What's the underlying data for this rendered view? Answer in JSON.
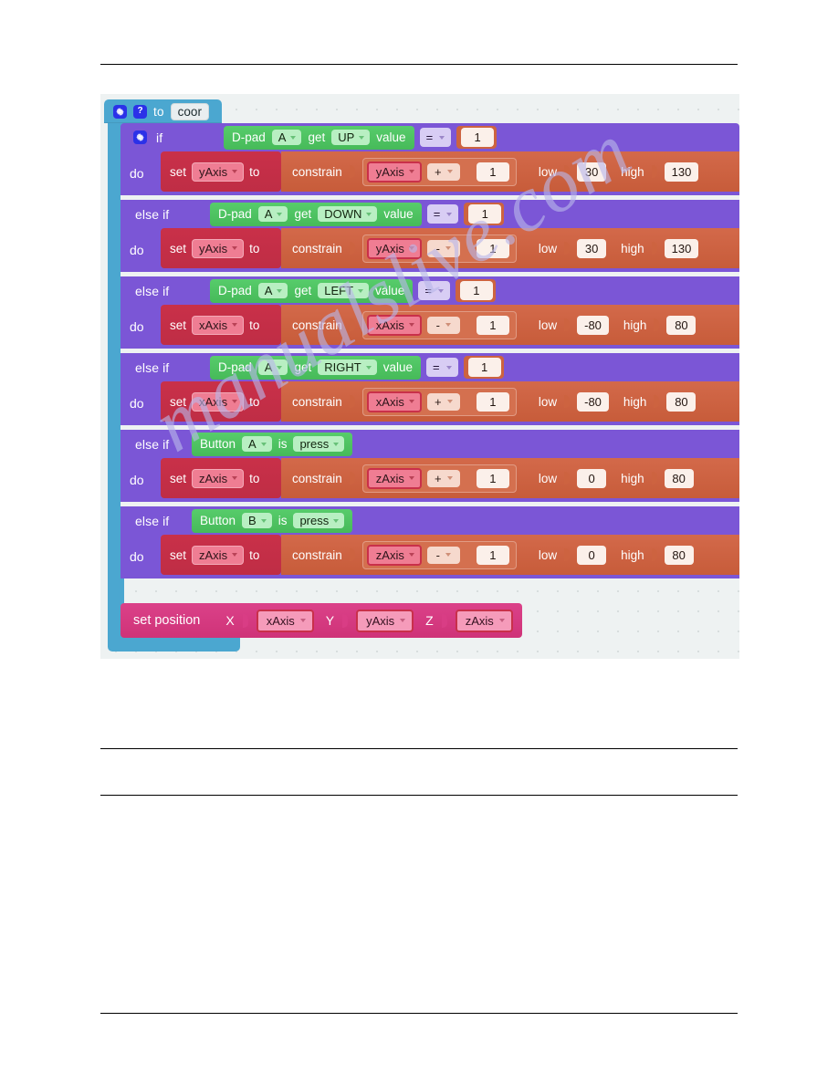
{
  "page": {
    "watermark": "manualslive.com"
  },
  "workspace": {
    "procedure": {
      "gear_icon": "gear-icon",
      "help_icon": "question-icon",
      "to_label": "to",
      "name": "coor"
    },
    "if_block": {
      "gear_icon": "gear-icon",
      "if_label": "if",
      "else_if_label": "else if",
      "do_label": "do"
    },
    "branches": [
      {
        "condition": {
          "kind": "dpad",
          "device": "D-pad",
          "port": "A",
          "get_label": "get",
          "direction": "UP",
          "value_label": "value",
          "operator": "=",
          "operand": "1"
        },
        "action": {
          "set_label": "set",
          "variable": "yAxis",
          "to_label": "to",
          "constrain_label": "constrain",
          "expr_var": "yAxis",
          "expr_op": "+",
          "expr_num": "1",
          "low_label": "low",
          "low": "30",
          "high_label": "high",
          "high": "130"
        }
      },
      {
        "condition": {
          "kind": "dpad",
          "device": "D-pad",
          "port": "A",
          "get_label": "get",
          "direction": "DOWN",
          "value_label": "value",
          "operator": "=",
          "operand": "1"
        },
        "action": {
          "set_label": "set",
          "variable": "yAxis",
          "to_label": "to",
          "constrain_label": "constrain",
          "expr_var": "yAxis",
          "expr_op": "-",
          "expr_num": "1",
          "low_label": "low",
          "low": "30",
          "high_label": "high",
          "high": "130"
        }
      },
      {
        "condition": {
          "kind": "dpad",
          "device": "D-pad",
          "port": "A",
          "get_label": "get",
          "direction": "LEFT",
          "value_label": "value",
          "operator": "=",
          "operand": "1"
        },
        "action": {
          "set_label": "set",
          "variable": "xAxis",
          "to_label": "to",
          "constrain_label": "constrain",
          "expr_var": "xAxis",
          "expr_op": "-",
          "expr_num": "1",
          "low_label": "low",
          "low": "-80",
          "high_label": "high",
          "high": "80"
        }
      },
      {
        "condition": {
          "kind": "dpad",
          "device": "D-pad",
          "port": "A",
          "get_label": "get",
          "direction": "RIGHT",
          "value_label": "value",
          "operator": "=",
          "operand": "1"
        },
        "action": {
          "set_label": "set",
          "variable": "xAxis",
          "to_label": "to",
          "constrain_label": "constrain",
          "expr_var": "xAxis",
          "expr_op": "+",
          "expr_num": "1",
          "low_label": "low",
          "low": "-80",
          "high_label": "high",
          "high": "80"
        }
      },
      {
        "condition": {
          "kind": "button",
          "device": "Button",
          "port": "A",
          "is_label": "is",
          "state": "press"
        },
        "action": {
          "set_label": "set",
          "variable": "zAxis",
          "to_label": "to",
          "constrain_label": "constrain",
          "expr_var": "zAxis",
          "expr_op": "+",
          "expr_num": "1",
          "low_label": "low",
          "low": "0",
          "high_label": "high",
          "high": "80"
        }
      },
      {
        "condition": {
          "kind": "button",
          "device": "Button",
          "port": "B",
          "is_label": "is",
          "state": "press"
        },
        "action": {
          "set_label": "set",
          "variable": "zAxis",
          "to_label": "to",
          "constrain_label": "constrain",
          "expr_var": "zAxis",
          "expr_op": "-",
          "expr_num": "1",
          "low_label": "low",
          "low": "0",
          "high_label": "high",
          "high": "80"
        }
      }
    ],
    "set_position": {
      "label": "set position",
      "x_label": "X",
      "x_value": "xAxis",
      "y_label": "Y",
      "y_value": "yAxis",
      "z_label": "Z",
      "z_value": "zAxis"
    }
  },
  "colors": {
    "procedure": "#4ba7d0",
    "control": "#7b56d6",
    "variable_set": "#c9304a",
    "math": "#cd6340",
    "sensing": "#4fc463",
    "motion": "#d93d85",
    "workspace_bg": "#eef2f2"
  }
}
